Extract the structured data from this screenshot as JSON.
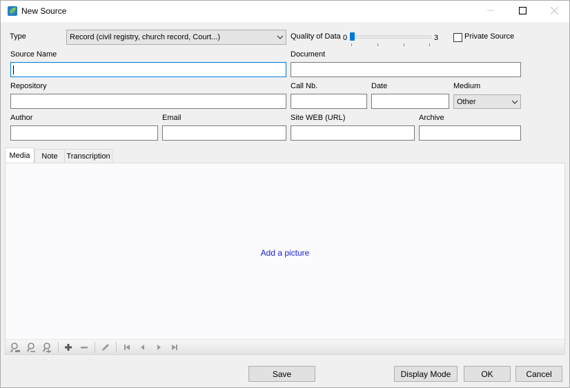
{
  "window": {
    "title": "New Source"
  },
  "form": {
    "type_label": "Type",
    "type_value": "Record (civil registry, church record, Court...)",
    "quality_label": "Quality of Data",
    "quality_min": "0",
    "quality_max": "3",
    "quality_value": 0,
    "private_label": "Private Source",
    "private_checked": false,
    "source_name_label": "Source Name",
    "document_label": "Document",
    "repository_label": "Repository",
    "call_nb_label": "Call Nb.",
    "date_label": "Date",
    "medium_label": "Medium",
    "medium_value": "Other",
    "author_label": "Author",
    "email_label": "Email",
    "site_label": "Site WEB (URL)",
    "archive_label": "Archive"
  },
  "tabs": [
    {
      "label": "Media",
      "active": true
    },
    {
      "label": "Note",
      "active": false
    },
    {
      "label": "Transcription",
      "active": false
    }
  ],
  "media": {
    "add_picture": "Add a picture",
    "toolbar_icons": [
      "zoom-100-icon",
      "zoom-out-icon",
      "zoom-in-icon",
      "add-icon",
      "remove-icon",
      "edit-pencil-icon",
      "first-icon",
      "previous-icon",
      "next-icon",
      "last-icon"
    ]
  },
  "buttons": {
    "save": "Save",
    "display_mode": "Display Mode",
    "ok": "OK",
    "cancel": "Cancel"
  },
  "colors": {
    "accent": "#0078d7",
    "link": "#1a1acc"
  }
}
